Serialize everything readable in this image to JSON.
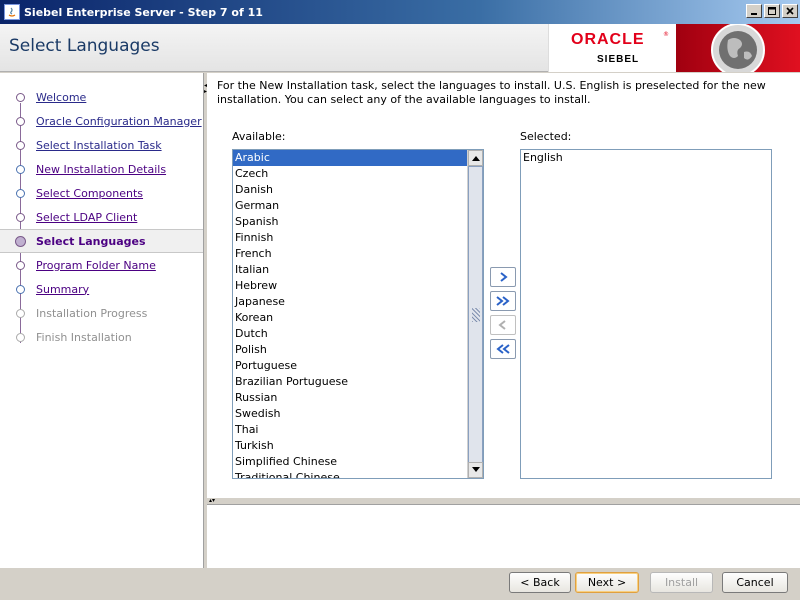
{
  "window": {
    "title": "Siebel Enterprise Server - Step 7 of 11"
  },
  "header": {
    "title": "Select Languages",
    "brand": "ORACLE",
    "brand_sub": "SIEBEL",
    "brand_reg": "®"
  },
  "nav": {
    "items": [
      {
        "label": "Welcome",
        "state": "done"
      },
      {
        "label": "Oracle Configuration Manager",
        "state": "done"
      },
      {
        "label": "Select Installation Task",
        "state": "done"
      },
      {
        "label": "New Installation Details",
        "state": "done"
      },
      {
        "label": "Select Components",
        "state": "done"
      },
      {
        "label": "Select LDAP Client",
        "state": "done"
      },
      {
        "label": "Select Languages",
        "state": "current"
      },
      {
        "label": "Program Folder Name",
        "state": "todo"
      },
      {
        "label": "Summary",
        "state": "todo"
      },
      {
        "label": "Installation Progress",
        "state": "future"
      },
      {
        "label": "Finish Installation",
        "state": "future"
      }
    ]
  },
  "main": {
    "instructions": "For the New Installation task, select the languages to install. U.S. English is preselected for the new installation. You can select any of the available languages to install.",
    "available_label": "Available:",
    "selected_label": "Selected:",
    "available": [
      "Arabic",
      "Czech",
      "Danish",
      "German",
      "Spanish",
      "Finnish",
      "French",
      "Italian",
      "Hebrew",
      "Japanese",
      "Korean",
      "Dutch",
      "Polish",
      "Portuguese",
      "Brazilian Portuguese",
      "Russian",
      "Swedish",
      "Thai",
      "Turkish",
      "Simplified Chinese",
      "Traditional Chinese"
    ],
    "available_selected_index": 0,
    "selected": [
      "English"
    ]
  },
  "footer": {
    "back": "< Back",
    "next": "Next >",
    "install": "Install",
    "cancel": "Cancel"
  },
  "colors": {
    "accent": "#316ac5",
    "nav_link": "#4b0082",
    "brand_red": "#e2001a"
  }
}
